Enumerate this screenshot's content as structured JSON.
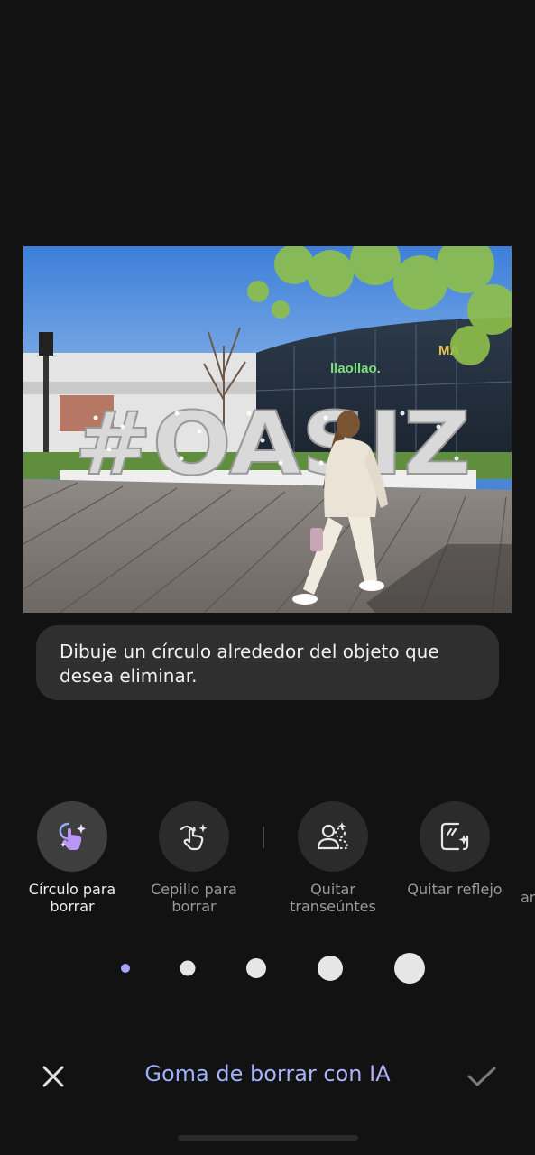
{
  "hint": {
    "text": "Dibuje un círculo alrededor del objeto que desea eliminar."
  },
  "photo": {
    "sign_text": "#OASIZ",
    "store_sign": "llaollao",
    "store_sign_2": "MA"
  },
  "tools": [
    {
      "label": "Círculo para borrar",
      "icon": "circle-erase-icon",
      "active": true
    },
    {
      "label": "Cepillo para borrar",
      "icon": "brush-erase-icon",
      "active": false
    },
    {
      "label": "Quitar transeúntes",
      "icon": "remove-people-icon",
      "active": false
    },
    {
      "label": "Quitar reflejo",
      "icon": "remove-reflection-icon",
      "active": false
    }
  ],
  "tools_partial_label": "ar",
  "brush_sizes": {
    "count": 5,
    "selected": 1,
    "selected_color": "#a7a4ff"
  },
  "bottom_bar": {
    "title": "Goma de borrar con IA",
    "close_icon": "close-icon",
    "confirm_icon": "check-icon"
  },
  "colors": {
    "background": "#121212",
    "accent": "#a7b8ff",
    "bubble": "#2f2f2f"
  }
}
